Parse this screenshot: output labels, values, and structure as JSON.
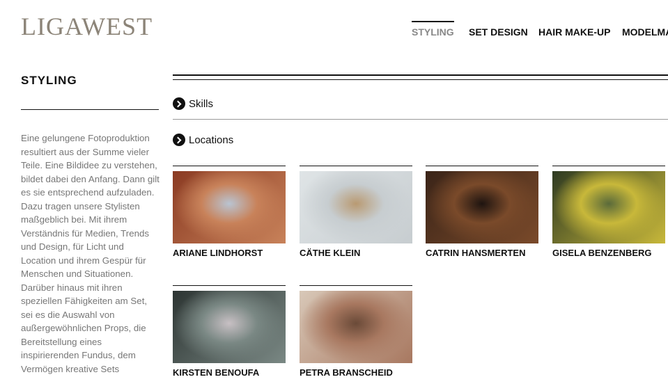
{
  "header": {
    "logo": "LIGAWEST",
    "nav": [
      "STYLING",
      "SET DESIGN",
      "HAIR MAKE-UP",
      "MODELMAK"
    ]
  },
  "sidebar": {
    "title": "STYLING",
    "text": "Eine gelungene Fotoproduktion resultiert aus der Summe vieler Teile. Eine Bildidee zu verstehen, bildet dabei den Anfang. Dann gilt es sie entsprechend aufzuladen. Dazu tragen unsere Stylisten maßgeblich bei. Mit ihrem Verständnis für Medien, Trends und Design, für Licht und Location und ihrem Gespür für Menschen und Situationen. Darüber hinaus mit ihren speziellen Fähigkeiten am Set, sei es die Auswahl von außergewöhnlichen Props, die Bereitstellung eines inspirierenden Fundus, dem Vermögen kreative Sets"
  },
  "accordions": [
    "Skills",
    "Locations"
  ],
  "artists": [
    {
      "name": "ARIANE LINDHORST",
      "colors": [
        "#8a3a22",
        "#c8825a",
        "#b9c4d2"
      ]
    },
    {
      "name": "CÄTHE KLEIN",
      "colors": [
        "#dfe4e6",
        "#c7cdd0",
        "#b99a72"
      ]
    },
    {
      "name": "CATRIN HANSMERTEN",
      "colors": [
        "#3a2418",
        "#7a4a2a",
        "#1e1410"
      ]
    },
    {
      "name": "GISELA BENZENBERG",
      "colors": [
        "#2e3a22",
        "#c8b83a",
        "#5a6a3a"
      ]
    },
    {
      "name": "KIRSTEN BENOUFA",
      "colors": [
        "#2c3432",
        "#7a8884",
        "#c8c0c4"
      ]
    },
    {
      "name": "PETRA BRANSCHEID",
      "colors": [
        "#d8c8b8",
        "#a87860",
        "#6a4a38"
      ]
    }
  ]
}
